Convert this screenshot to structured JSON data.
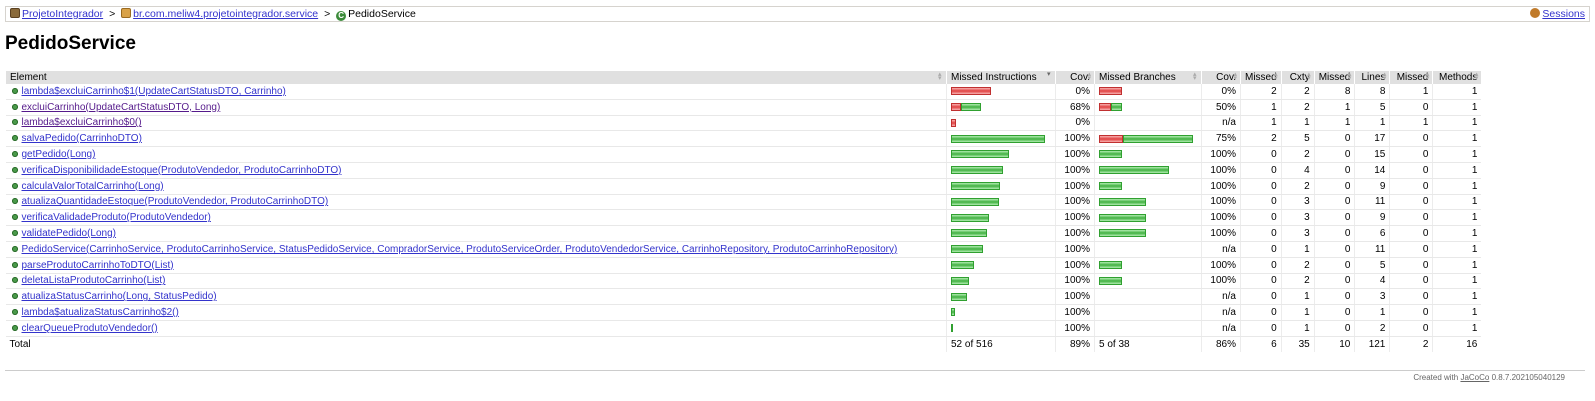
{
  "breadcrumb": {
    "report": "ProjetoIntegrador",
    "package": "br.com.meliw4.projetointegrador.service",
    "class_name": "PedidoService",
    "separator": ">",
    "sessions": "Sessions"
  },
  "page_title": "PedidoService",
  "columns": [
    "Element",
    "Missed Instructions",
    "Cov.",
    "Missed Branches",
    "Cov.",
    "Missed",
    "Cxty",
    "Missed",
    "Lines",
    "Missed",
    "Methods"
  ],
  "rows": [
    {
      "name": "lambda$excluiCarrinho$1(UpdateCartStatusDTO, Carrinho)",
      "visited": false,
      "instr_missed": 1.0,
      "instr_width": 40,
      "instr_cov": "0%",
      "br_missed": 1.0,
      "br_width": 23,
      "br_cov": "0%",
      "cx_missed": "2",
      "cxty": "2",
      "ln_missed": "8",
      "lines": "8",
      "m_missed": "1",
      "methods": "1"
    },
    {
      "name": "excluiCarrinho(UpdateCartStatusDTO, Long)",
      "visited": true,
      "instr_missed": 0.32,
      "instr_width": 30,
      "instr_cov": "68%",
      "br_missed": 0.5,
      "br_width": 23,
      "br_cov": "50%",
      "cx_missed": "1",
      "cxty": "2",
      "ln_missed": "1",
      "lines": "5",
      "m_missed": "0",
      "methods": "1"
    },
    {
      "name": "lambda$excluiCarrinho$0()",
      "visited": true,
      "instr_missed": 1.0,
      "instr_width": 5,
      "instr_cov": "0%",
      "br_missed": null,
      "br_width": 0,
      "br_cov": "n/a",
      "cx_missed": "1",
      "cxty": "1",
      "ln_missed": "1",
      "lines": "1",
      "m_missed": "1",
      "methods": "1"
    },
    {
      "name": "salvaPedido(CarrinhoDTO)",
      "visited": false,
      "instr_missed": 0.0,
      "instr_width": 94,
      "instr_cov": "100%",
      "br_missed": 0.25,
      "br_width": 94,
      "br_cov": "75%",
      "cx_missed": "2",
      "cxty": "5",
      "ln_missed": "0",
      "lines": "17",
      "m_missed": "0",
      "methods": "1"
    },
    {
      "name": "getPedido(Long)",
      "visited": false,
      "instr_missed": 0.0,
      "instr_width": 58,
      "instr_cov": "100%",
      "br_missed": 0.0,
      "br_width": 23,
      "br_cov": "100%",
      "cx_missed": "0",
      "cxty": "2",
      "ln_missed": "0",
      "lines": "15",
      "m_missed": "0",
      "methods": "1"
    },
    {
      "name": "verificaDisponibilidadeEstoque(ProdutoVendedor, ProdutoCarrinhoDTO)",
      "visited": false,
      "instr_missed": 0.0,
      "instr_width": 52,
      "instr_cov": "100%",
      "br_missed": 0.0,
      "br_width": 70,
      "br_cov": "100%",
      "cx_missed": "0",
      "cxty": "4",
      "ln_missed": "0",
      "lines": "14",
      "m_missed": "0",
      "methods": "1"
    },
    {
      "name": "calculaValorTotalCarrinho(Long)",
      "visited": false,
      "instr_missed": 0.0,
      "instr_width": 49,
      "instr_cov": "100%",
      "br_missed": 0.0,
      "br_width": 23,
      "br_cov": "100%",
      "cx_missed": "0",
      "cxty": "2",
      "ln_missed": "0",
      "lines": "9",
      "m_missed": "0",
      "methods": "1"
    },
    {
      "name": "atualizaQuantidadeEstoque(ProdutoVendedor, ProdutoCarrinhoDTO)",
      "visited": false,
      "instr_missed": 0.0,
      "instr_width": 48,
      "instr_cov": "100%",
      "br_missed": 0.0,
      "br_width": 47,
      "br_cov": "100%",
      "cx_missed": "0",
      "cxty": "3",
      "ln_missed": "0",
      "lines": "11",
      "m_missed": "0",
      "methods": "1"
    },
    {
      "name": "verificaValidadeProduto(ProdutoVendedor)",
      "visited": false,
      "instr_missed": 0.0,
      "instr_width": 38,
      "instr_cov": "100%",
      "br_missed": 0.0,
      "br_width": 47,
      "br_cov": "100%",
      "cx_missed": "0",
      "cxty": "3",
      "ln_missed": "0",
      "lines": "9",
      "m_missed": "0",
      "methods": "1"
    },
    {
      "name": "validatePedido(Long)",
      "visited": false,
      "instr_missed": 0.0,
      "instr_width": 36,
      "instr_cov": "100%",
      "br_missed": 0.0,
      "br_width": 47,
      "br_cov": "100%",
      "cx_missed": "0",
      "cxty": "3",
      "ln_missed": "0",
      "lines": "6",
      "m_missed": "0",
      "methods": "1"
    },
    {
      "name": "PedidoService(CarrinhoService, ProdutoCarrinhoService, StatusPedidoService, CompradorService, ProdutoServiceOrder, ProdutoVendedorService, CarrinhoRepository, ProdutoCarrinhoRepository)",
      "visited": false,
      "instr_missed": 0.0,
      "instr_width": 32,
      "instr_cov": "100%",
      "br_missed": null,
      "br_width": 0,
      "br_cov": "n/a",
      "cx_missed": "0",
      "cxty": "1",
      "ln_missed": "0",
      "lines": "11",
      "m_missed": "0",
      "methods": "1"
    },
    {
      "name": "parseProdutoCarrinhoToDTO(List)",
      "visited": false,
      "instr_missed": 0.0,
      "instr_width": 23,
      "instr_cov": "100%",
      "br_missed": 0.0,
      "br_width": 23,
      "br_cov": "100%",
      "cx_missed": "0",
      "cxty": "2",
      "ln_missed": "0",
      "lines": "5",
      "m_missed": "0",
      "methods": "1"
    },
    {
      "name": "deletaListaProdutoCarrinho(List)",
      "visited": false,
      "instr_missed": 0.0,
      "instr_width": 18,
      "instr_cov": "100%",
      "br_missed": 0.0,
      "br_width": 23,
      "br_cov": "100%",
      "cx_missed": "0",
      "cxty": "2",
      "ln_missed": "0",
      "lines": "4",
      "m_missed": "0",
      "methods": "1"
    },
    {
      "name": "atualizaStatusCarrinho(Long, StatusPedido)",
      "visited": false,
      "instr_missed": 0.0,
      "instr_width": 16,
      "instr_cov": "100%",
      "br_missed": null,
      "br_width": 0,
      "br_cov": "n/a",
      "cx_missed": "0",
      "cxty": "1",
      "ln_missed": "0",
      "lines": "3",
      "m_missed": "0",
      "methods": "1"
    },
    {
      "name": "lambda$atualizaStatusCarrinho$2()",
      "visited": false,
      "instr_missed": 0.0,
      "instr_width": 4,
      "instr_cov": "100%",
      "br_missed": null,
      "br_width": 0,
      "br_cov": "n/a",
      "cx_missed": "0",
      "cxty": "1",
      "ln_missed": "0",
      "lines": "1",
      "m_missed": "0",
      "methods": "1"
    },
    {
      "name": "clearQueueProdutoVendedor()",
      "visited": false,
      "instr_missed": 0.0,
      "instr_width": 2,
      "instr_cov": "100%",
      "br_missed": null,
      "br_width": 0,
      "br_cov": "n/a",
      "cx_missed": "0",
      "cxty": "1",
      "ln_missed": "0",
      "lines": "2",
      "m_missed": "0",
      "methods": "1"
    }
  ],
  "total": {
    "label": "Total",
    "instr": "52 of 516",
    "instr_cov": "89%",
    "br": "5 of 38",
    "br_cov": "86%",
    "cx_missed": "6",
    "cxty": "35",
    "ln_missed": "10",
    "lines": "121",
    "m_missed": "2",
    "methods": "16"
  },
  "footer": {
    "prefix": "Created with ",
    "link": "JaCoCo",
    "version": " 0.8.7.202105040129"
  },
  "colors": {
    "covered": "#40b040",
    "missed": "#e04040",
    "link": "#3333cc",
    "visited": "#551a8b"
  }
}
